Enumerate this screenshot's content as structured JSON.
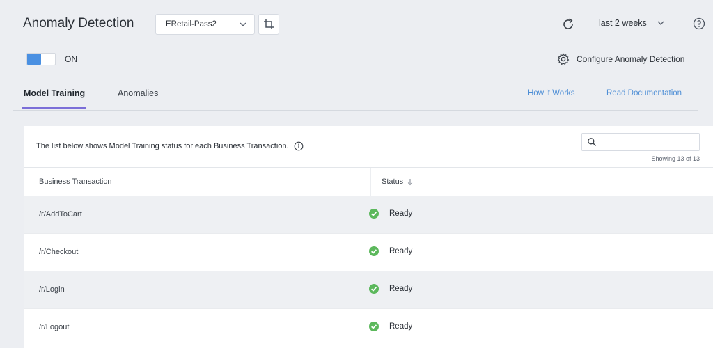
{
  "header": {
    "title": "Anomaly Detection",
    "application": "ERetail-Pass2",
    "time_range": "last 2 weeks"
  },
  "toggle": {
    "label": "ON",
    "on": true
  },
  "configure_label": "Configure Anomaly Detection",
  "tabs": [
    {
      "label": "Model Training",
      "active": true
    },
    {
      "label": "Anomalies",
      "active": false
    }
  ],
  "links": {
    "how_it_works": "How it Works",
    "read_documentation": "Read Documentation"
  },
  "panel": {
    "description": "The list below shows Model Training status for each Business Transaction.",
    "search_placeholder": "",
    "showing": "Showing 13 of 13"
  },
  "table": {
    "columns": [
      "Business Transaction",
      "Status"
    ],
    "rows": [
      {
        "name": "/r/AddToCart",
        "status": "Ready"
      },
      {
        "name": "/r/Checkout",
        "status": "Ready"
      },
      {
        "name": "/r/Login",
        "status": "Ready"
      },
      {
        "name": "/r/Logout",
        "status": "Ready"
      }
    ]
  },
  "colors": {
    "accent": "#7b6ed8",
    "toggle_on": "#4a90e2",
    "link": "#4f8fd6",
    "status_ready": "#5cb85c"
  }
}
